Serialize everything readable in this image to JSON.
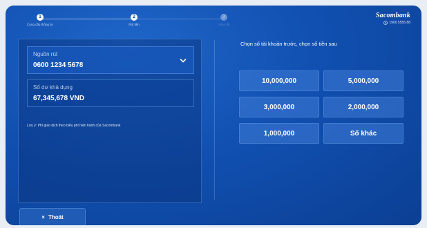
{
  "stepper": {
    "steps": [
      {
        "number": "1",
        "label": "Cung cấp thông tin",
        "state": "active"
      },
      {
        "number": "2",
        "label": "Rút tiền",
        "state": "active"
      },
      {
        "number": "3",
        "label": "Hoàn tất",
        "state": "inactive"
      }
    ]
  },
  "brand": {
    "name": "Sacombank",
    "phone": "1900 5555 88"
  },
  "source": {
    "label": "Nguồn rút",
    "value": "0600 1234 5678"
  },
  "balance": {
    "label": "Số dư khả dụng",
    "value": "67,345,678 VND"
  },
  "note": "Lưu ý: Phí giao dịch theo biểu phí hiện hành của Sacombank",
  "instruction": "Chọn số tài khoản trước, chọn số tiền sau",
  "amounts": [
    {
      "label": "10,000,000"
    },
    {
      "label": "5,000,000"
    },
    {
      "label": "3,000,000"
    },
    {
      "label": "2,000,000"
    },
    {
      "label": "1,000,000"
    },
    {
      "label": "Số khác"
    }
  ],
  "exit": {
    "icon": "×",
    "label": "Thoát"
  },
  "colors": {
    "background": "#1150b1",
    "panel": "#0b3f93",
    "text": "#ffffff"
  }
}
